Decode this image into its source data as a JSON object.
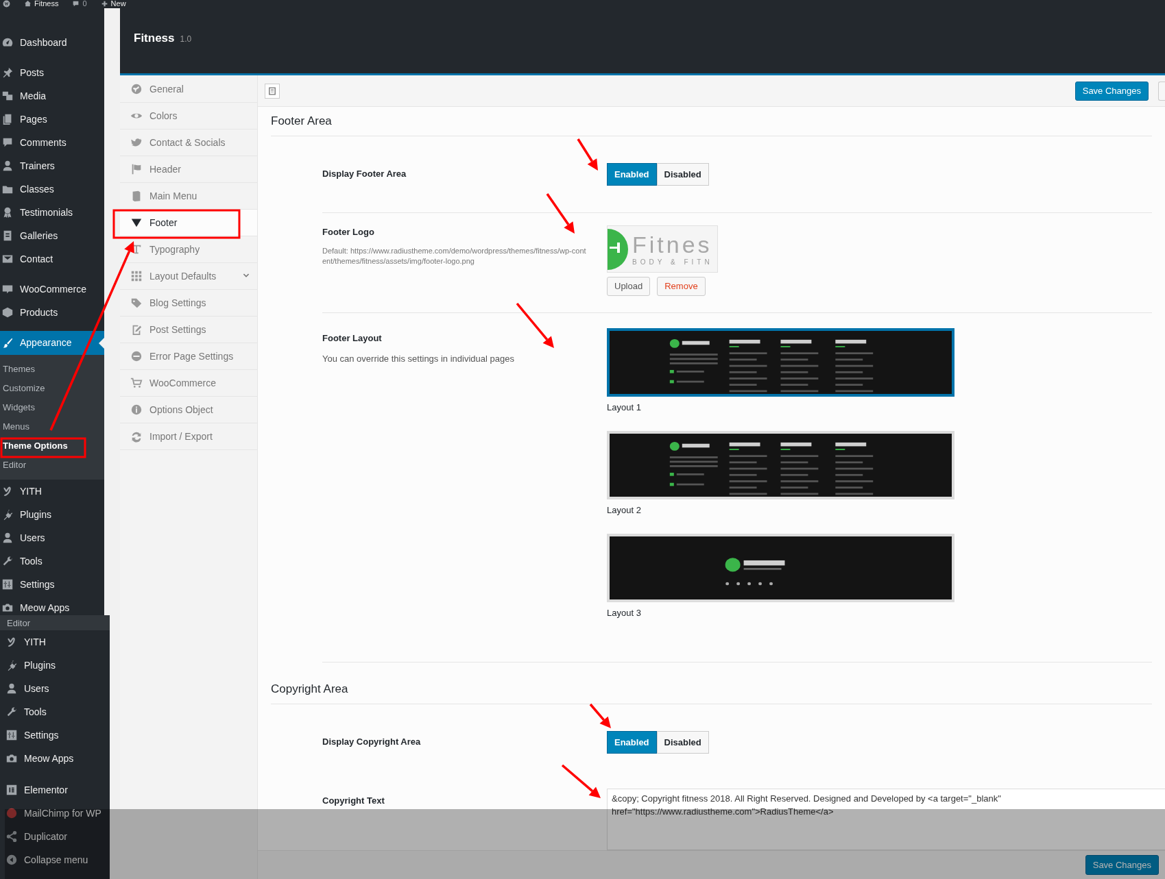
{
  "admin_bar": {
    "site": "Fitness",
    "comments": "0",
    "new": "New"
  },
  "sidebar": {
    "groups": [
      {
        "items": [
          {
            "label": "Dashboard",
            "selected": false
          }
        ]
      },
      {
        "items": [
          {
            "label": "Posts",
            "selected": false
          },
          {
            "label": "Media",
            "selected": false
          },
          {
            "label": "Pages",
            "selected": false
          },
          {
            "label": "Comments",
            "selected": false
          },
          {
            "label": "Trainers",
            "selected": false
          },
          {
            "label": "Classes",
            "selected": false
          },
          {
            "label": "Testimonials",
            "selected": false
          },
          {
            "label": "Galleries",
            "selected": false
          },
          {
            "label": "Contact",
            "selected": false
          }
        ]
      },
      {
        "items": [
          {
            "label": "WooCommerce",
            "selected": false
          },
          {
            "label": "Products",
            "selected": false
          }
        ]
      },
      {
        "items": [
          {
            "label": "Appearance",
            "selected": true,
            "children": [
              {
                "label": "Themes",
                "selected": false
              },
              {
                "label": "Customize",
                "selected": false
              },
              {
                "label": "Widgets",
                "selected": false
              },
              {
                "label": "Menus",
                "selected": false
              },
              {
                "label": "Theme Options",
                "selected": true
              },
              {
                "label": "Editor",
                "selected": false
              }
            ]
          },
          {
            "label": "YITH",
            "selected": false
          },
          {
            "label": "Plugins",
            "selected": false
          },
          {
            "label": "Users",
            "selected": false
          },
          {
            "label": "Tools",
            "selected": false
          },
          {
            "label": "Settings",
            "selected": false
          },
          {
            "label": "Meow Apps",
            "selected": false
          }
        ]
      }
    ]
  },
  "overlay_menu": {
    "groups": [
      {
        "items": [
          {
            "label": "Editor",
            "kind": "submenu"
          },
          {
            "label": "YITH",
            "kind": "menu"
          },
          {
            "label": "Plugins",
            "kind": "menu"
          },
          {
            "label": "Users",
            "kind": "menu"
          },
          {
            "label": "Tools",
            "kind": "menu"
          },
          {
            "label": "Settings",
            "kind": "menu"
          },
          {
            "label": "Meow Apps",
            "kind": "menu"
          }
        ]
      },
      {
        "items": [
          {
            "label": "Elementor",
            "kind": "menu"
          },
          {
            "label": "MailChimp for WP",
            "kind": "menu"
          },
          {
            "label": "Duplicator",
            "kind": "menu"
          },
          {
            "label": "Collapse menu",
            "kind": "menu"
          }
        ]
      }
    ]
  },
  "options_header": {
    "title": "Fitness",
    "version": "1.0"
  },
  "options_nav": [
    {
      "label": "General",
      "selected": false,
      "collapsible": false
    },
    {
      "label": "Colors",
      "selected": false,
      "collapsible": false
    },
    {
      "label": "Contact & Socials",
      "selected": false,
      "collapsible": false
    },
    {
      "label": "Header",
      "selected": false,
      "collapsible": false
    },
    {
      "label": "Main Menu",
      "selected": false,
      "collapsible": false
    },
    {
      "label": "Footer",
      "selected": true,
      "collapsible": false
    },
    {
      "label": "Typography",
      "selected": false,
      "collapsible": false
    },
    {
      "label": "Layout Defaults",
      "selected": false,
      "collapsible": true
    },
    {
      "label": "Blog Settings",
      "selected": false,
      "collapsible": false
    },
    {
      "label": "Post Settings",
      "selected": false,
      "collapsible": false
    },
    {
      "label": "Error Page Settings",
      "selected": false,
      "collapsible": false
    },
    {
      "label": "WooCommerce",
      "selected": false,
      "collapsible": false
    },
    {
      "label": "Options Object",
      "selected": false,
      "collapsible": false
    },
    {
      "label": "Import / Export",
      "selected": false,
      "collapsible": false
    }
  ],
  "toolbar": {
    "save_button": "Save Changes"
  },
  "sections": [
    {
      "title": "Footer Area",
      "fields": [
        {
          "kind": "toggle",
          "label": "Display Footer Area",
          "options": [
            {
              "label": "Enabled",
              "selected": true
            },
            {
              "label": "Disabled",
              "selected": false
            }
          ]
        },
        {
          "kind": "media",
          "label": "Footer Logo",
          "description": "Default: https://www.radiustheme.com/demo/wordpress/themes/fitness/wp-content/themes/fitness/assets/img/footer-logo.png",
          "logo": {
            "wordmark": "Fitnes",
            "tagline": "BODY & FITN"
          },
          "buttons": [
            {
              "label": "Upload",
              "kind": "default"
            },
            {
              "label": "Remove",
              "kind": "danger"
            }
          ]
        },
        {
          "kind": "layouts",
          "label": "Footer Layout",
          "description": "You can override this settings in individual pages",
          "layouts": [
            {
              "label": "Layout 1",
              "selected": true,
              "kind": "columns"
            },
            {
              "label": "Layout 2",
              "selected": false,
              "kind": "columns"
            },
            {
              "label": "Layout 3",
              "selected": false,
              "kind": "centered"
            }
          ]
        }
      ]
    },
    {
      "title": "Copyright Area",
      "fields": [
        {
          "kind": "toggle",
          "label": "Display Copyright Area",
          "options": [
            {
              "label": "Enabled",
              "selected": true
            },
            {
              "label": "Disabled",
              "selected": false
            }
          ]
        },
        {
          "kind": "textarea",
          "label": "Copyright Text",
          "value": "&copy; Copyright fitness 2018. All Right Reserved. Designed and Developed by <a target=\"_blank\" href=\"https://www.radiustheme.com\">RadiusTheme</a>"
        }
      ]
    }
  ],
  "bottom_bar": {
    "save_button": "Save Changes"
  }
}
